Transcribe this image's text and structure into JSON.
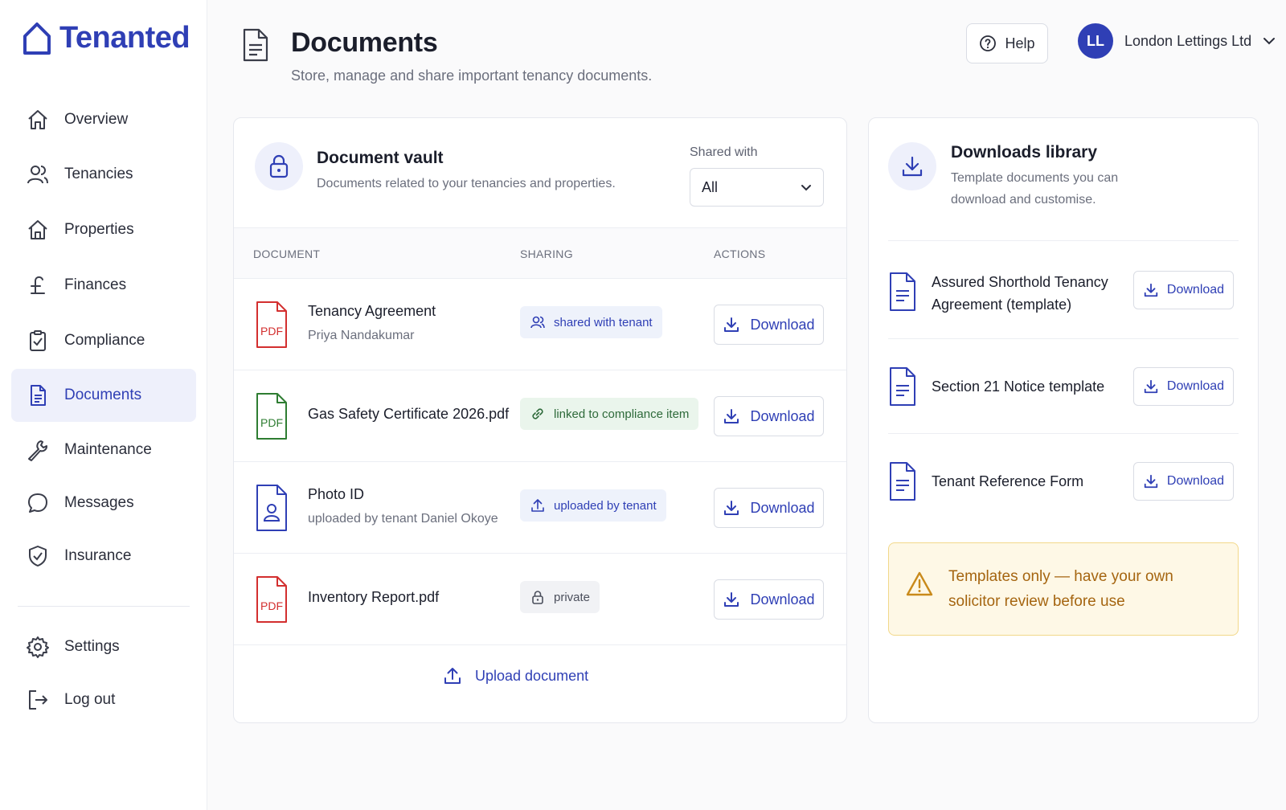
{
  "app": {
    "name": "Tenanted",
    "brand_color": "#2f3fb5"
  },
  "sidebar": {
    "items": [
      {
        "label": "Overview",
        "icon": "home-icon"
      },
      {
        "label": "Tenancies",
        "icon": "users-icon"
      },
      {
        "label": "Properties",
        "icon": "house-icon"
      },
      {
        "label": "Finances",
        "icon": "pound-icon"
      },
      {
        "label": "Compliance",
        "icon": "clipboard-check-icon"
      },
      {
        "label": "Documents",
        "icon": "document-icon",
        "active": true
      },
      {
        "label": "Maintenance",
        "icon": "wrench-icon"
      },
      {
        "label": "Messages",
        "icon": "chat-bubble-icon"
      },
      {
        "label": "Insurance",
        "icon": "shield-check-icon"
      }
    ],
    "bottom_items": [
      {
        "label": "Settings",
        "icon": "gear-icon"
      },
      {
        "label": "Log out",
        "icon": "logout-icon"
      }
    ]
  },
  "header": {
    "title": "Documents",
    "subtitle": "Store, manage and share important tenancy documents.",
    "help_label": "Help",
    "user": {
      "initials": "LL",
      "name": "London Lettings Ltd"
    }
  },
  "vault": {
    "title": "Document vault",
    "subtitle": "Documents related to your tenancies and properties.",
    "filter_label": "Shared with",
    "filter_value": "All",
    "columns": [
      "DOCUMENT",
      "SHARING",
      "ACTIONS"
    ],
    "rows": [
      {
        "name": "Tenancy Agreement",
        "sub": "Priya Nandakumar",
        "file_type": "PDF",
        "file_color": "#d32f2f",
        "sharing": "shared with tenant",
        "sharing_icon": "user-icon",
        "action": "Download"
      },
      {
        "name": "Gas Safety Certificate 2026.pdf",
        "sub": "",
        "file_type": "PDF",
        "file_color": "#2e7d32",
        "sharing": "linked to compliance item",
        "sharing_icon": "link-icon",
        "action": "Download"
      },
      {
        "name": "Photo ID",
        "sub": "uploaded by tenant Daniel Okoye",
        "file_type": "",
        "file_color": "#2f3fb5",
        "sharing": "uploaded by tenant",
        "sharing_icon": "upload-icon",
        "action": "Download"
      },
      {
        "name": "Inventory Report.pdf",
        "sub": "",
        "file_type": "PDF",
        "file_color": "#d32f2f",
        "sharing": "private",
        "sharing_icon": "lock-icon",
        "action": "Download"
      }
    ],
    "upload_label": "Upload document"
  },
  "library": {
    "title": "Downloads library",
    "subtitle_line1": "Template documents you can",
    "subtitle_line2": "download and customise.",
    "items": [
      {
        "name_line1": "Assured Shorthold Tenancy",
        "name_line2": "Agreement (template)",
        "action": "Download"
      },
      {
        "name_line1": "Section 21 Notice template",
        "name_line2": "",
        "action": "Download"
      },
      {
        "name_line1": "Tenant Reference Form",
        "name_line2": "",
        "action": "Download"
      }
    ],
    "warning_line1": "Templates only — have your own",
    "warning_line2": "solicitor review before use",
    "warning_color": "#a56510"
  }
}
